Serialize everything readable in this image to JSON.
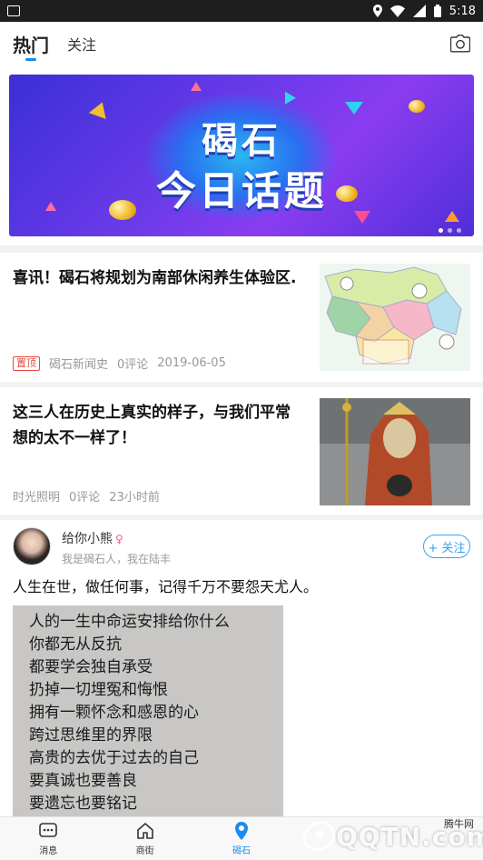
{
  "status_bar": {
    "time": "5:18"
  },
  "top_nav": {
    "tab_hot": "热门",
    "tab_follow": "关注",
    "camera_icon": "camera-icon"
  },
  "banner": {
    "line1": "碣石",
    "line2": "今日话题",
    "dots_total": 3,
    "dots_active": 1
  },
  "news": [
    {
      "title": "喜讯！碣石将规划为南部休闲养生体验区.",
      "badge": "置顶",
      "source": "碣石新闻史",
      "comments": "0评论",
      "date": "2019-06-05"
    },
    {
      "title": "这三人在历史上真实的样子，与我们平常想的太不一样了！",
      "source": "时光照明",
      "comments": "0评论",
      "date": "23小时前"
    }
  ],
  "post": {
    "username": "给你小熊",
    "gender_symbol": "♀",
    "bio": "我是碣石人，我在陆丰",
    "follow_label": "+ 关注",
    "text": "人生在世，做任何事，记得千万不要怨天尤人。",
    "image_lines": [
      "人的一生中命运安排给你什么",
      "你都无从反抗",
      "都要学会独自承受",
      "扔掉一切埋冤和悔恨",
      "拥有一颗怀念和感恩的心",
      "跨过思维里的界限",
      "高贵的去优于过去的自己",
      "要真诚也要善良",
      "要遗忘也要铭记"
    ]
  },
  "tab_bar": [
    {
      "label": "消息",
      "icon": "chat-icon"
    },
    {
      "label": "商街",
      "icon": "home-icon"
    },
    {
      "label": "碣石",
      "icon": "location-pin-icon",
      "active": true
    },
    {
      "label": "",
      "icon": ""
    },
    {
      "label": "",
      "icon": ""
    }
  ],
  "watermark": {
    "text": "QQTN.com",
    "small": "腾牛网"
  },
  "colors": {
    "accent": "#1a8cf0",
    "badge_red": "#e24b3b",
    "follow_blue": "#38a3f0"
  }
}
